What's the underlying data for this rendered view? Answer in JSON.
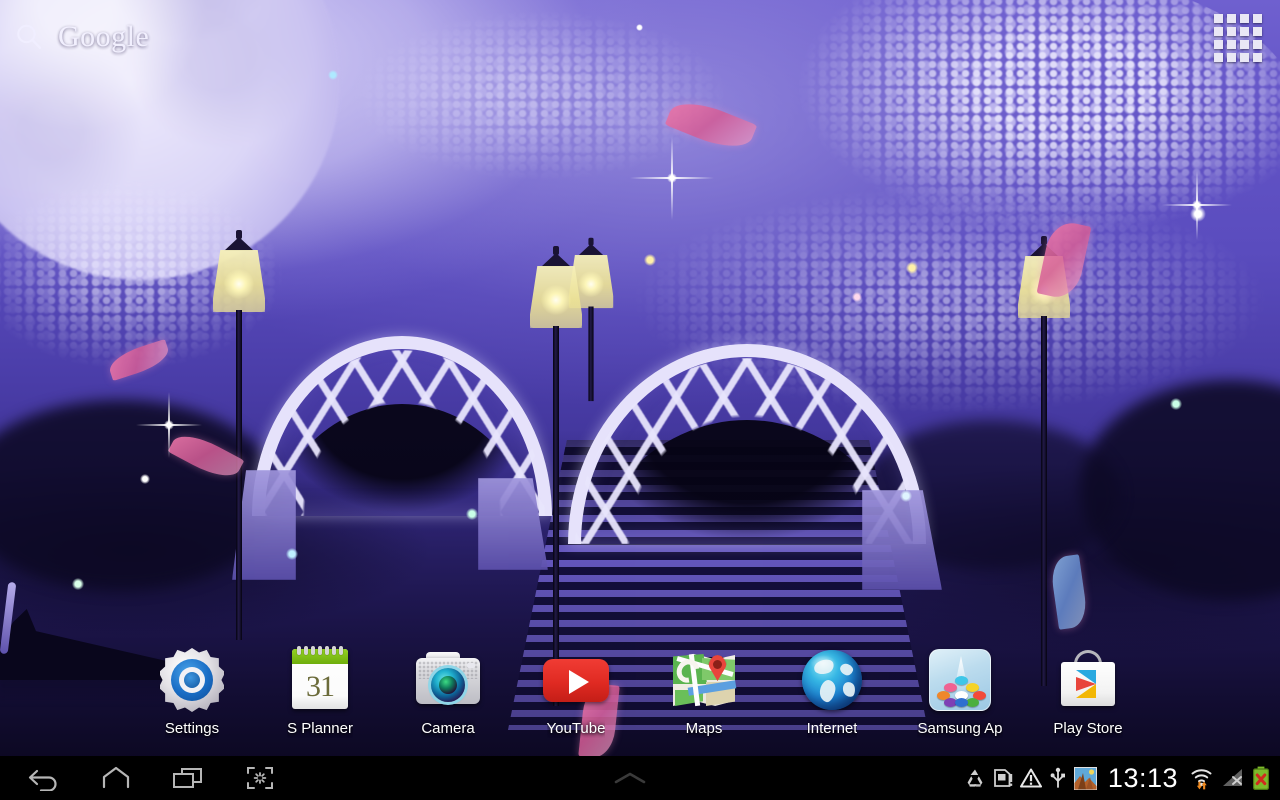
{
  "device": {
    "platform": "android-tablet-home",
    "orientation": "landscape"
  },
  "search_widget": {
    "icon": "search-icon",
    "brand_label": "Google",
    "placeholder": "Google"
  },
  "apps_button": {
    "icon": "apps-grid-icon",
    "label": "Apps",
    "rows": 4,
    "cols": 4
  },
  "wallpaper": {
    "description": "Night park scene with white arched bridges, stone stairs, glowing street lamps, cherry blossoms, full moon and gondola",
    "colors": {
      "sky_top": "#6f60cf",
      "sky_bottom": "#120e30",
      "moon": "#efecfd",
      "lamp_glow": "#fcf3b0",
      "bridge": "#e6e2fb",
      "feather_pink": "#e478aa",
      "feather_blue": "#96bef0"
    }
  },
  "dock": {
    "items": [
      {
        "id": "settings",
        "label": "Settings",
        "icon": "settings-gear-icon"
      },
      {
        "id": "s-planner",
        "label": "S Planner",
        "icon": "calendar-icon",
        "badge": "31"
      },
      {
        "id": "camera",
        "label": "Camera",
        "icon": "camera-icon"
      },
      {
        "id": "youtube",
        "label": "YouTube",
        "icon": "youtube-icon"
      },
      {
        "id": "maps",
        "label": "Maps",
        "icon": "maps-icon"
      },
      {
        "id": "internet",
        "label": "Internet",
        "icon": "globe-icon"
      },
      {
        "id": "samsung-apps",
        "label": "Samsung Ap",
        "icon": "samsung-apps-icon"
      },
      {
        "id": "play-store",
        "label": "Play Store",
        "icon": "play-store-icon"
      }
    ]
  },
  "system_bar": {
    "nav": [
      {
        "id": "back",
        "icon": "back-arrow-icon",
        "label": "Back"
      },
      {
        "id": "home",
        "icon": "home-icon",
        "label": "Home"
      },
      {
        "id": "recents",
        "icon": "recent-apps-icon",
        "label": "Recent apps"
      },
      {
        "id": "screenshot",
        "icon": "screen-capture-icon",
        "label": "Screen capture"
      }
    ],
    "center": {
      "id": "expand-handle",
      "icon": "chevron-up-icon",
      "label": "Show notifications"
    },
    "clock": "13:13",
    "status_icons": [
      {
        "id": "recycle",
        "icon": "recycle-icon"
      },
      {
        "id": "sd-card",
        "icon": "sd-card-warning-icon"
      },
      {
        "id": "warning",
        "icon": "warning-triangle-icon"
      },
      {
        "id": "usb",
        "icon": "usb-icon"
      },
      {
        "id": "screenshot-thumb",
        "icon": "image-thumbnail-icon"
      },
      {
        "id": "wifi",
        "icon": "wifi-transfer-icon"
      },
      {
        "id": "signal",
        "icon": "signal-no-service-icon"
      },
      {
        "id": "battery",
        "icon": "battery-error-icon"
      }
    ]
  }
}
